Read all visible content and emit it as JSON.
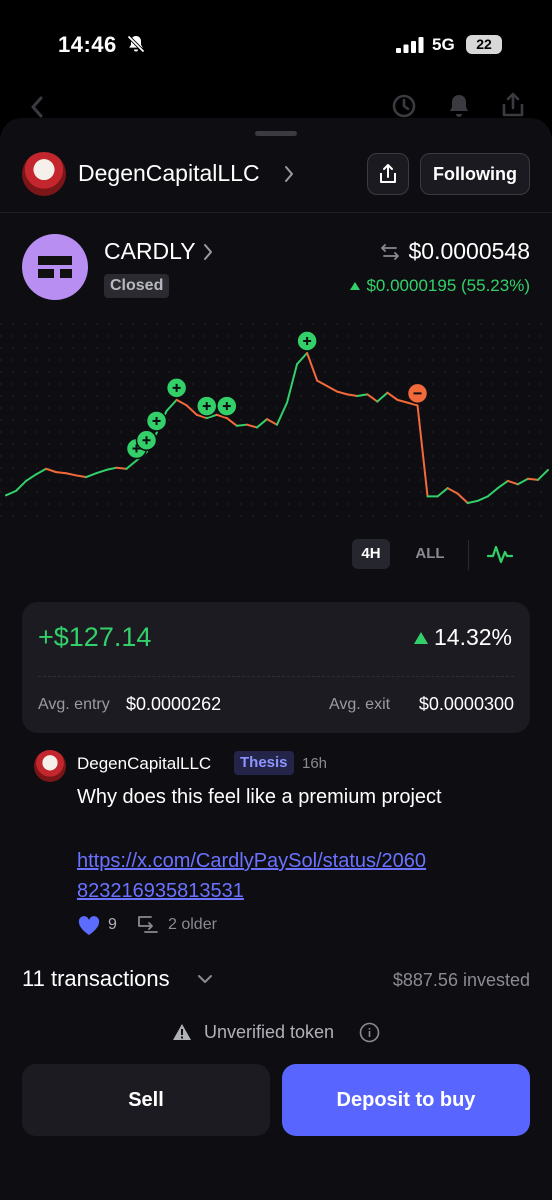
{
  "status_bar": {
    "time": "14:46",
    "network": "5G",
    "battery": "22"
  },
  "profile": {
    "name": "DegenCapitalLLC",
    "follow_label": "Following"
  },
  "token": {
    "name": "CARDLY",
    "status": "Closed",
    "price": "$0.0000548",
    "change": "$0.0000195 (55.23%)"
  },
  "colors": {
    "accent": "#5866ff",
    "gain": "#33d06a",
    "loss": "#f26a3a",
    "background": "#0e0e12"
  },
  "chart_data": {
    "type": "line",
    "timeframe": "4H",
    "grid": true,
    "series": [
      {
        "values": [
          2.22e-05,
          2.3e-05,
          2.48e-05,
          2.6e-05,
          2.7e-05,
          2.64e-05,
          2.62e-05,
          2.58e-05,
          2.55e-05,
          2.62e-05,
          2.68e-05,
          2.72e-05,
          2.7e-05,
          2.85e-05,
          3e-05,
          3.35e-05,
          3.75e-05,
          3.95e-05,
          3.85e-05,
          3.68e-05,
          3.62e-05,
          3.68e-05,
          3.62e-05,
          3.48e-05,
          3.5e-05,
          3.45e-05,
          3.6e-05,
          3.5e-05,
          3.9e-05,
          4.6e-05,
          4.8e-05,
          4.3e-05,
          4.2e-05,
          4.1e-05,
          4.05e-05,
          4.02e-05,
          4.05e-05,
          3.92e-05,
          4.08e-05,
          3.95e-05,
          3.9e-05,
          3.85e-05,
          2.2e-05,
          2.2e-05,
          2.35e-05,
          2.25e-05,
          2.08e-05,
          2.12e-05,
          2.2e-05,
          2.35e-05,
          2.48e-05,
          2.42e-05,
          2.52e-05,
          2.5e-05,
          2.68e-05
        ]
      }
    ],
    "buys": [
      13,
      14,
      15,
      17,
      20,
      22,
      30
    ],
    "sells": [
      41
    ]
  },
  "timeframes": {
    "active": "4H",
    "other": "ALL"
  },
  "pnl": {
    "value": "+$127.14",
    "percent": "14.32%",
    "entry_label": "Avg. entry",
    "entry_value": "$0.0000262",
    "exit_label": "Avg. exit",
    "exit_value": "$0.0000300"
  },
  "post": {
    "author": "DegenCapitalLLC",
    "tag": "Thesis",
    "time": "16h",
    "text": "Why does this feel like a premium project",
    "link": "https://x.com/CardlyPaySol/status/2060823216935813531",
    "likes": "9",
    "older": "2 older"
  },
  "transactions": {
    "count_label": "11 transactions",
    "invested": "$887.56 invested"
  },
  "warning": {
    "text": "Unverified token"
  },
  "actions": {
    "sell": "Sell",
    "buy": "Deposit to buy"
  }
}
